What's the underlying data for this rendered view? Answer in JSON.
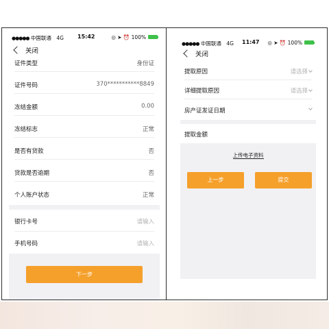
{
  "left": {
    "status": {
      "carrier": "中国联通",
      "network": "4G",
      "time": "15:42",
      "battery": "100%"
    },
    "nav": {
      "back_label": "关闭"
    },
    "rows": [
      {
        "label": "证件类型",
        "value": "身份证"
      },
      {
        "label": "证件号码",
        "value": "370***********8849"
      },
      {
        "label": "冻结金额",
        "value": "0.00"
      },
      {
        "label": "冻结标志",
        "value": "正常"
      },
      {
        "label": "是否有贷款",
        "value": "否"
      },
      {
        "label": "贷款是否逾期",
        "value": "否"
      },
      {
        "label": "个人账户状态",
        "value": "正常"
      }
    ],
    "inputs": [
      {
        "label": "银行卡号",
        "placeholder": "请输入"
      },
      {
        "label": "手机号码",
        "placeholder": "请输入"
      }
    ],
    "next_button": "下一步"
  },
  "right": {
    "status": {
      "carrier": "中国联通",
      "network": "4G",
      "time": "11:47",
      "battery": "100%"
    },
    "nav": {
      "back_label": "关闭"
    },
    "selects": [
      {
        "label": "提取原因",
        "placeholder": "请选择"
      },
      {
        "label": "详细提取原因",
        "placeholder": "请选择"
      },
      {
        "label": "房产证发证日期",
        "placeholder": ""
      }
    ],
    "amount_label": "提取金额",
    "upload_link": "上传电子资料",
    "prev_button": "上一步",
    "submit_button": "提交"
  },
  "colors": {
    "accent": "#f5a02b",
    "battery": "#3ec14a",
    "band": "#f1f1f4"
  }
}
